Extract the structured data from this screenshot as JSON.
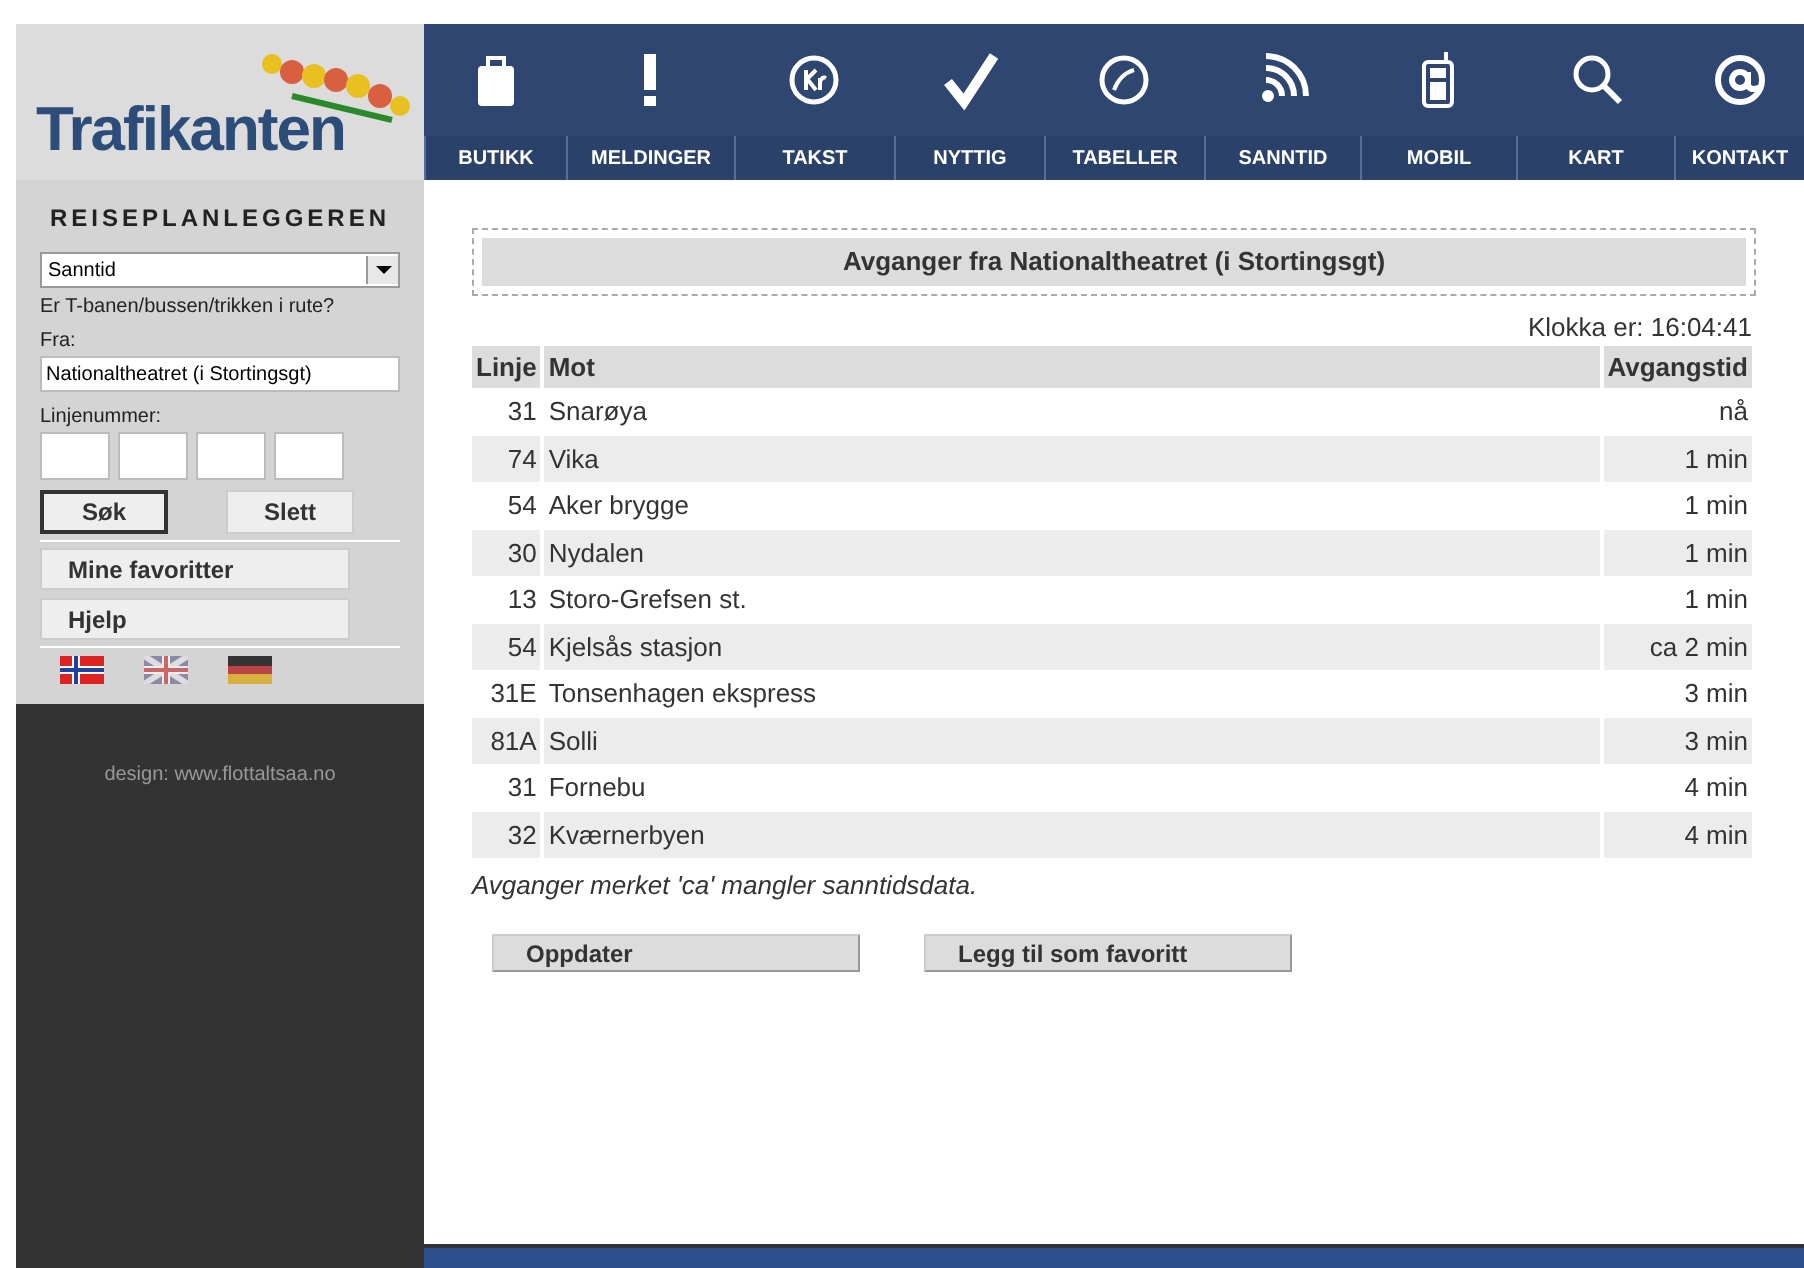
{
  "logo": {
    "text": "Trafikanten"
  },
  "nav": [
    {
      "label": "BUTIKK",
      "kind": "bag"
    },
    {
      "label": "MELDINGER",
      "kind": "exclaim"
    },
    {
      "label": "TAKST",
      "kind": "kr"
    },
    {
      "label": "NYTTIG",
      "kind": "check"
    },
    {
      "label": "TABELLER",
      "kind": "clock"
    },
    {
      "label": "SANNTID",
      "kind": "signal"
    },
    {
      "label": "MOBIL",
      "kind": "phone"
    },
    {
      "label": "KART",
      "kind": "search"
    },
    {
      "label": "KONTAKT",
      "kind": "at"
    }
  ],
  "sidebar": {
    "heading": "REISEPLANLEGGEREN",
    "mode_select": {
      "value": "Sanntid"
    },
    "question": "Er T-banen/bussen/trikken i rute?",
    "from_label": "Fra:",
    "from_value": "Nationaltheatret (i Stortingsgt)",
    "line_label": "Linjenummer:",
    "line_fields": [
      {
        "kind": "input"
      },
      {
        "kind": "input"
      },
      {
        "kind": "input"
      },
      {
        "kind": "input"
      }
    ],
    "buttons": [
      {
        "label": "Søk",
        "selected": true
      },
      {
        "label": "Slett",
        "selected": false
      }
    ],
    "links": [
      "Mine favoritter",
      "Hjelp"
    ],
    "flags": [
      {
        "kind": "norway"
      },
      {
        "kind": "uk"
      },
      {
        "kind": "germany"
      }
    ],
    "credit": "design: www.flottaltsaa.no"
  },
  "main": {
    "title": "Avganger fra Nationaltheatret (i Stortingsgt)",
    "clock": "Klokka er: 16:04:41",
    "table": {
      "columns": [
        "Linje",
        "Mot",
        "Avgangstid"
      ],
      "rows": [
        [
          "31",
          "Snarøya",
          "nå"
        ],
        [
          "74",
          "Vika",
          "1 min"
        ],
        [
          "54",
          "Aker brygge",
          "1 min"
        ],
        [
          "30",
          "Nydalen",
          "1 min"
        ],
        [
          "13",
          "Storo-Grefsen st.",
          "1 min"
        ],
        [
          "54",
          "Kjelsås stasjon",
          "ca 2 min"
        ],
        [
          "31E",
          "Tonsenhagen ekspress",
          "3 min"
        ],
        [
          "81A",
          "Solli",
          "3 min"
        ],
        [
          "31",
          "Fornebu",
          "4 min"
        ],
        [
          "32",
          "Kværnerbyen",
          "4 min"
        ]
      ]
    },
    "note": "Avganger merket 'ca' mangler sanntidsdata.",
    "buttons": [
      "Oppdater",
      "Legg til som favoritt"
    ]
  }
}
